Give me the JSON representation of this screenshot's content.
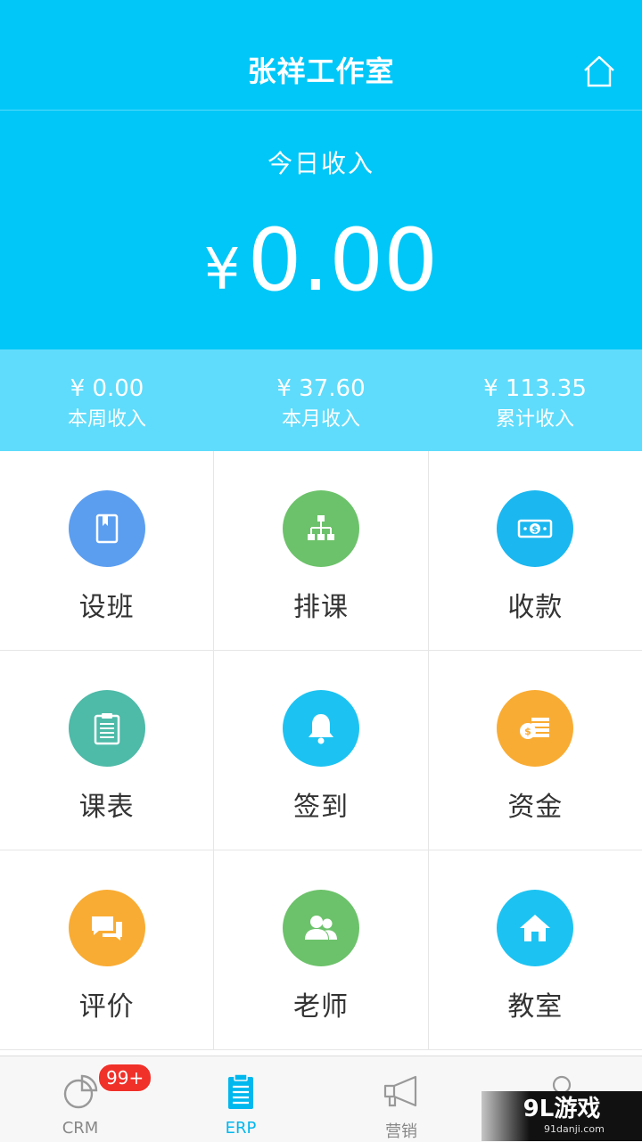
{
  "header": {
    "title": "张祥工作室"
  },
  "today": {
    "label": "今日收入",
    "currency": "¥",
    "amount": "0.00"
  },
  "stats": [
    {
      "value": "¥ 0.00",
      "label": "本周收入"
    },
    {
      "value": "¥ 37.60",
      "label": "本月收入"
    },
    {
      "value": "¥ 113.35",
      "label": "累计收入"
    }
  ],
  "grid": [
    {
      "label": "设班",
      "icon": "book-icon",
      "color": "#5b9ef0"
    },
    {
      "label": "排课",
      "icon": "org-chart-icon",
      "color": "#6cc26a"
    },
    {
      "label": "收款",
      "icon": "cash-icon",
      "color": "#1bb7f0"
    },
    {
      "label": "课表",
      "icon": "clipboard-icon",
      "color": "#4ebaa8"
    },
    {
      "label": "签到",
      "icon": "bell-icon",
      "color": "#1cc3f2"
    },
    {
      "label": "资金",
      "icon": "coins-icon",
      "color": "#f9ac33"
    },
    {
      "label": "评价",
      "icon": "chat-icon",
      "color": "#f9ac33"
    },
    {
      "label": "老师",
      "icon": "users-icon",
      "color": "#6cc26a"
    },
    {
      "label": "教室",
      "icon": "house-icon",
      "color": "#1cc3f2"
    }
  ],
  "tabbar": {
    "badge": "99+",
    "tabs": [
      {
        "label": "CRM",
        "icon": "pie-chart-icon"
      },
      {
        "label": "ERP",
        "icon": "clipboard-icon"
      },
      {
        "label": "营销",
        "icon": "megaphone-icon"
      },
      {
        "label": "",
        "icon": "person-icon"
      }
    ]
  },
  "watermark": {
    "brand": "9L游戏",
    "url": "91danji.com"
  }
}
